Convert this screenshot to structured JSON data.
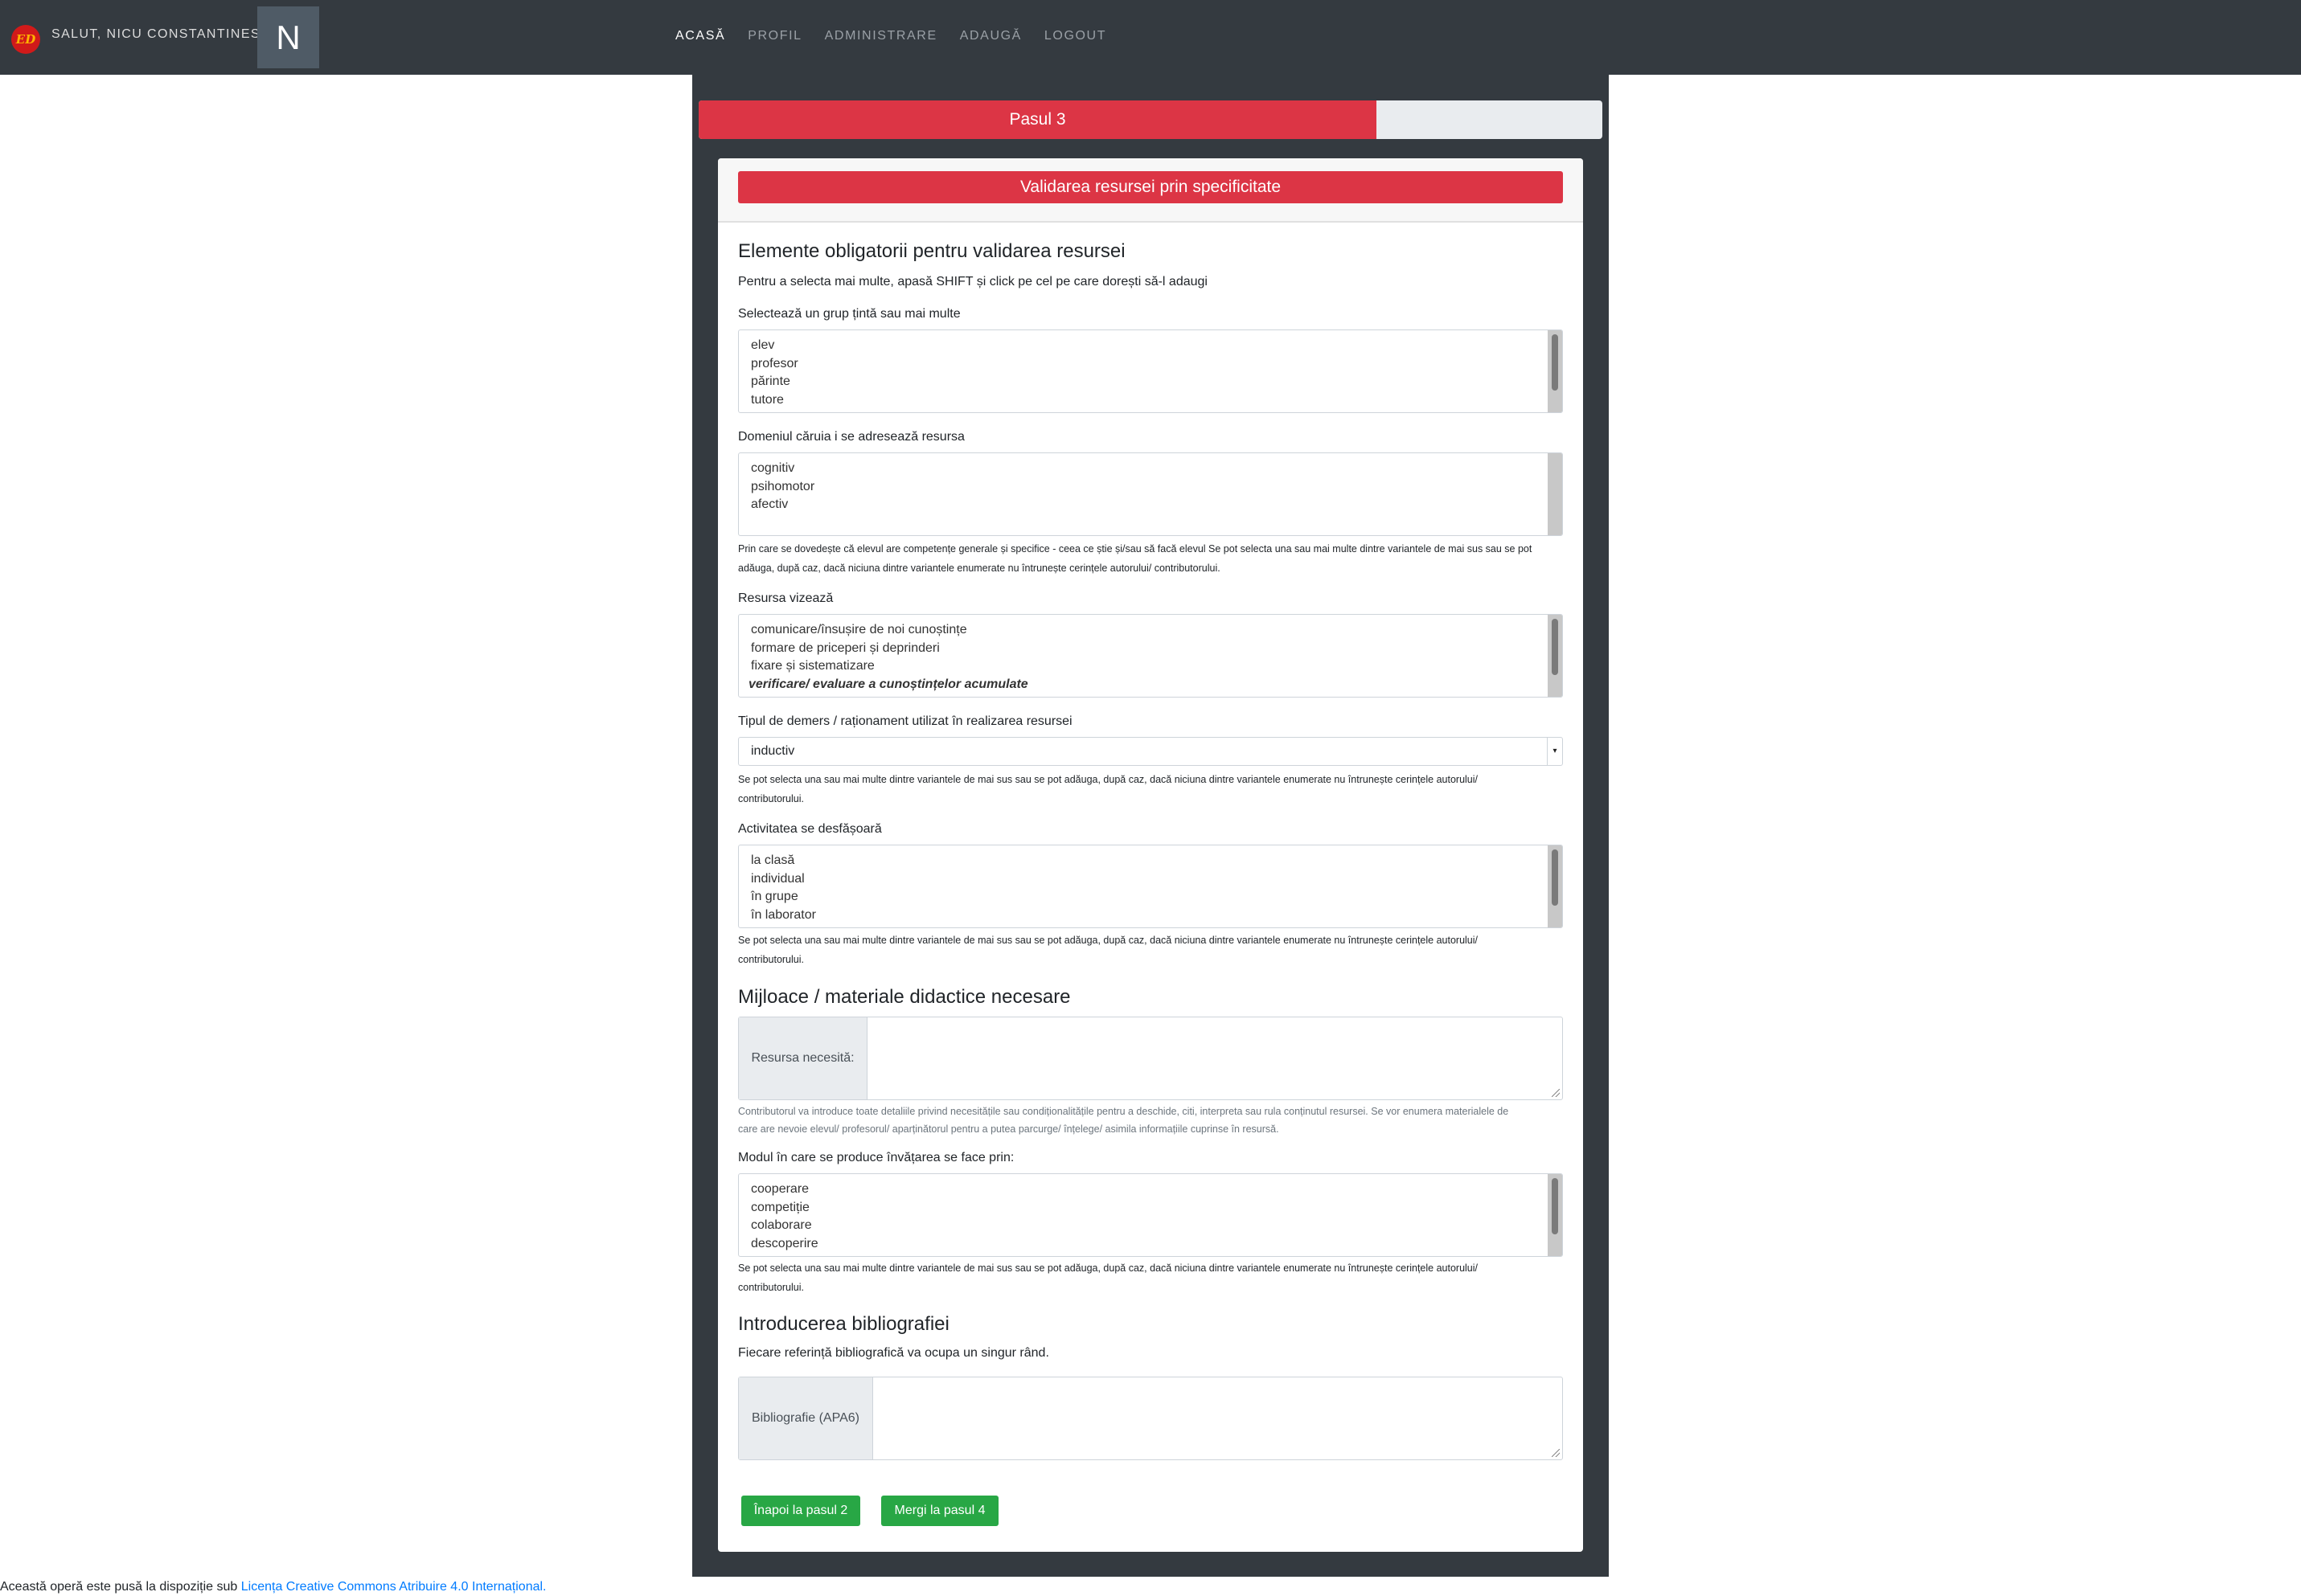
{
  "navbar": {
    "greeting": "SALUT, NICU CONSTANTINESCU",
    "avatar_letter": "N",
    "links": [
      "ACASĂ",
      "PROFIL",
      "ADMINISTRARE",
      "ADAUGĂ",
      "LOGOUT"
    ],
    "active_link": "ACASĂ"
  },
  "progress": {
    "label": "Pasul 3",
    "value_percent": 75,
    "fill_color": "#dc3545"
  },
  "card": {
    "header_title": "Validarea resursei prin specificitate",
    "section1_title": "Elemente obligatorii pentru validarea resursei",
    "multi_select_hint": "Pentru a selecta mai multe, apasă SHIFT și click pe cel pe care dorești să-l adaugi",
    "target_group": {
      "label": "Selectează un grup țintă sau mai multe",
      "options": [
        "elev",
        "profesor",
        "părinte",
        "tutore"
      ]
    },
    "domain": {
      "label": "Domeniul căruia i se adresează resursa",
      "options": [
        "cognitiv",
        "psihomotor",
        "afectiv"
      ],
      "help_line1": "Prin care se dovedește că elevul are competențe generale și specifice - ceea ce știe și/sau să facă elevul Se pot selecta una sau mai multe dintre variantele de mai sus sau se pot",
      "help_line2": "adăuga, după caz, dacă niciuna dintre variantele enumerate nu întrunește cerințele autorului/ contributorului."
    },
    "resource_aims": {
      "label": "Resursa vizează",
      "options": [
        "comunicare/însușire de noi cunoștințe",
        "formare de priceperi și deprinderi",
        "fixare și sistematizare",
        "verificare/ evaluare a cunoștințelor acumulate"
      ],
      "selected": "verificare/ evaluare a cunoștințelor acumulate"
    },
    "reasoning": {
      "label": "Tipul de demers / raționament utilizat în realizarea resursei",
      "value": "inductiv",
      "help_line1": "Se pot selecta una sau mai multe dintre variantele de mai sus sau se pot adăuga, după caz, dacă niciuna dintre variantele enumerate nu întrunește cerințele autorului/",
      "help_line2": "contributorului."
    },
    "activity": {
      "label": "Activitatea se desfășoară",
      "options": [
        "la clasă",
        "individual",
        "în grupe",
        "în laborator"
      ],
      "help_line1": "Se pot selecta una sau mai multe dintre variantele de mai sus sau se pot adăuga, după caz, dacă niciuna dintre variantele enumerate nu întrunește cerințele autorului/",
      "help_line2": "contributorului."
    },
    "section2_title": "Mijloace / materiale didactice necesare",
    "resource_needs": {
      "addon": "Resursa necesită:",
      "value": "",
      "help_line1": "Contributorul va introduce toate detaliile privind necesitățile sau condiționalitățile pentru a deschide, citi, interpreta sau rula conținutul resursei. Se vor enumera materialele de",
      "help_line2": "care are nevoie elevul/ profesorul/ aparținătorul pentru a putea parcurge/ înțelege/ asimila informațiile cuprinse în resursă."
    },
    "learning_mode": {
      "label": "Modul în care se produce învățarea se face prin:",
      "options": [
        "cooperare",
        "competiție",
        "colaborare",
        "descoperire"
      ],
      "help_line1": "Se pot selecta una sau mai multe dintre variantele de mai sus sau se pot adăuga, după caz, dacă niciuna dintre variantele enumerate nu întrunește cerințele autorului/",
      "help_line2": "contributorului."
    },
    "section3_title": "Introducerea bibliografiei",
    "bibliography_hint": "Fiecare referință bibliografică va ocupa un singur rând.",
    "bibliography": {
      "addon": "Bibliografie (APA6)",
      "value": ""
    },
    "back_button": "Înapoi la pasul 2",
    "next_button": "Mergi la pasul 4"
  },
  "footer": {
    "text": "Această operă este pusă la dispoziție sub ",
    "link": "Licența Creative Commons Atribuire 4.0 Internațional."
  }
}
